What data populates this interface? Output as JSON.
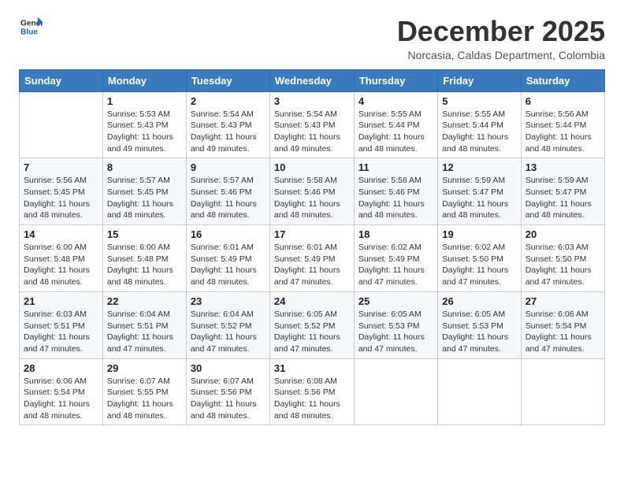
{
  "header": {
    "logo_line1": "General",
    "logo_line2": "Blue",
    "month": "December 2025",
    "location": "Norcasia, Caldas Department, Colombia"
  },
  "weekdays": [
    "Sunday",
    "Monday",
    "Tuesday",
    "Wednesday",
    "Thursday",
    "Friday",
    "Saturday"
  ],
  "weeks": [
    [
      {
        "day": "",
        "info": ""
      },
      {
        "day": "1",
        "info": "Sunrise: 5:53 AM\nSunset: 5:43 PM\nDaylight: 11 hours\nand 49 minutes."
      },
      {
        "day": "2",
        "info": "Sunrise: 5:54 AM\nSunset: 5:43 PM\nDaylight: 11 hours\nand 49 minutes."
      },
      {
        "day": "3",
        "info": "Sunrise: 5:54 AM\nSunset: 5:43 PM\nDaylight: 11 hours\nand 49 minutes."
      },
      {
        "day": "4",
        "info": "Sunrise: 5:55 AM\nSunset: 5:44 PM\nDaylight: 11 hours\nand 48 minutes."
      },
      {
        "day": "5",
        "info": "Sunrise: 5:55 AM\nSunset: 5:44 PM\nDaylight: 11 hours\nand 48 minutes."
      },
      {
        "day": "6",
        "info": "Sunrise: 5:56 AM\nSunset: 5:44 PM\nDaylight: 11 hours\nand 48 minutes."
      }
    ],
    [
      {
        "day": "7",
        "info": "Sunrise: 5:56 AM\nSunset: 5:45 PM\nDaylight: 11 hours\nand 48 minutes."
      },
      {
        "day": "8",
        "info": "Sunrise: 5:57 AM\nSunset: 5:45 PM\nDaylight: 11 hours\nand 48 minutes."
      },
      {
        "day": "9",
        "info": "Sunrise: 5:57 AM\nSunset: 5:46 PM\nDaylight: 11 hours\nand 48 minutes."
      },
      {
        "day": "10",
        "info": "Sunrise: 5:58 AM\nSunset: 5:46 PM\nDaylight: 11 hours\nand 48 minutes."
      },
      {
        "day": "11",
        "info": "Sunrise: 5:58 AM\nSunset: 5:46 PM\nDaylight: 11 hours\nand 48 minutes."
      },
      {
        "day": "12",
        "info": "Sunrise: 5:59 AM\nSunset: 5:47 PM\nDaylight: 11 hours\nand 48 minutes."
      },
      {
        "day": "13",
        "info": "Sunrise: 5:59 AM\nSunset: 5:47 PM\nDaylight: 11 hours\nand 48 minutes."
      }
    ],
    [
      {
        "day": "14",
        "info": "Sunrise: 6:00 AM\nSunset: 5:48 PM\nDaylight: 11 hours\nand 48 minutes."
      },
      {
        "day": "15",
        "info": "Sunrise: 6:00 AM\nSunset: 5:48 PM\nDaylight: 11 hours\nand 48 minutes."
      },
      {
        "day": "16",
        "info": "Sunrise: 6:01 AM\nSunset: 5:49 PM\nDaylight: 11 hours\nand 48 minutes."
      },
      {
        "day": "17",
        "info": "Sunrise: 6:01 AM\nSunset: 5:49 PM\nDaylight: 11 hours\nand 47 minutes."
      },
      {
        "day": "18",
        "info": "Sunrise: 6:02 AM\nSunset: 5:49 PM\nDaylight: 11 hours\nand 47 minutes."
      },
      {
        "day": "19",
        "info": "Sunrise: 6:02 AM\nSunset: 5:50 PM\nDaylight: 11 hours\nand 47 minutes."
      },
      {
        "day": "20",
        "info": "Sunrise: 6:03 AM\nSunset: 5:50 PM\nDaylight: 11 hours\nand 47 minutes."
      }
    ],
    [
      {
        "day": "21",
        "info": "Sunrise: 6:03 AM\nSunset: 5:51 PM\nDaylight: 11 hours\nand 47 minutes."
      },
      {
        "day": "22",
        "info": "Sunrise: 6:04 AM\nSunset: 5:51 PM\nDaylight: 11 hours\nand 47 minutes."
      },
      {
        "day": "23",
        "info": "Sunrise: 6:04 AM\nSunset: 5:52 PM\nDaylight: 11 hours\nand 47 minutes."
      },
      {
        "day": "24",
        "info": "Sunrise: 6:05 AM\nSunset: 5:52 PM\nDaylight: 11 hours\nand 47 minutes."
      },
      {
        "day": "25",
        "info": "Sunrise: 6:05 AM\nSunset: 5:53 PM\nDaylight: 11 hours\nand 47 minutes."
      },
      {
        "day": "26",
        "info": "Sunrise: 6:05 AM\nSunset: 5:53 PM\nDaylight: 11 hours\nand 47 minutes."
      },
      {
        "day": "27",
        "info": "Sunrise: 6:06 AM\nSunset: 5:54 PM\nDaylight: 11 hours\nand 47 minutes."
      }
    ],
    [
      {
        "day": "28",
        "info": "Sunrise: 6:06 AM\nSunset: 5:54 PM\nDaylight: 11 hours\nand 48 minutes."
      },
      {
        "day": "29",
        "info": "Sunrise: 6:07 AM\nSunset: 5:55 PM\nDaylight: 11 hours\nand 48 minutes."
      },
      {
        "day": "30",
        "info": "Sunrise: 6:07 AM\nSunset: 5:56 PM\nDaylight: 11 hours\nand 48 minutes."
      },
      {
        "day": "31",
        "info": "Sunrise: 6:08 AM\nSunset: 5:56 PM\nDaylight: 11 hours\nand 48 minutes."
      },
      {
        "day": "",
        "info": ""
      },
      {
        "day": "",
        "info": ""
      },
      {
        "day": "",
        "info": ""
      }
    ]
  ]
}
